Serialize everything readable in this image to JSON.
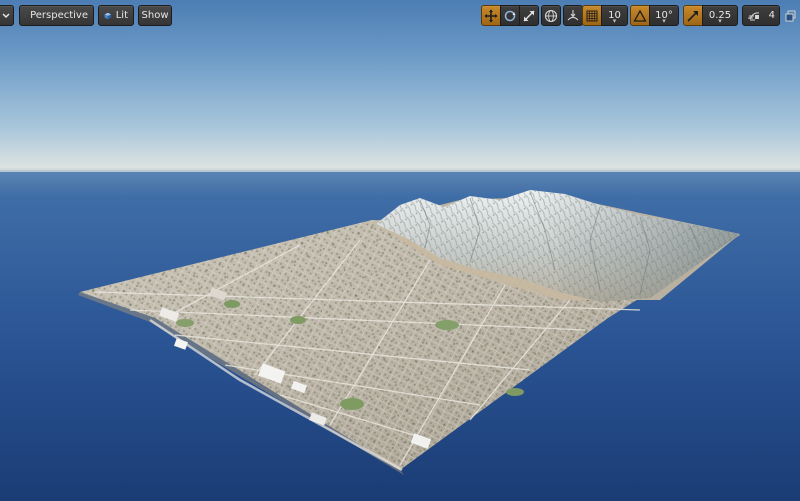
{
  "toolbar": {
    "perspective_label": "Perspective",
    "lit_label": "Lit",
    "show_label": "Show",
    "grid_snap_value": "10",
    "rotation_snap_value": "10°",
    "scale_snap_value": "0.25",
    "camera_speed_value": "4"
  },
  "icons": {
    "viewport_menu": "chevron-down-icon",
    "perspective": "perspective-icon",
    "lit": "lit-cube-icon",
    "translate": "translate-icon",
    "rotate": "rotate-icon",
    "scale": "scale-icon",
    "world_local": "globe-icon",
    "surface_snap": "surface-snap-icon",
    "grid_snap": "grid-icon",
    "rotation_snap": "angle-icon",
    "scale_snap": "scale-snap-icon",
    "camera_speed": "camera-speed-icon",
    "maximize": "maximize-icon"
  },
  "colors": {
    "active_accent": "#c98a2c",
    "sky_top": "#4d7fb6",
    "horizon": "#dfe5e3",
    "ocean": "#234a86"
  }
}
